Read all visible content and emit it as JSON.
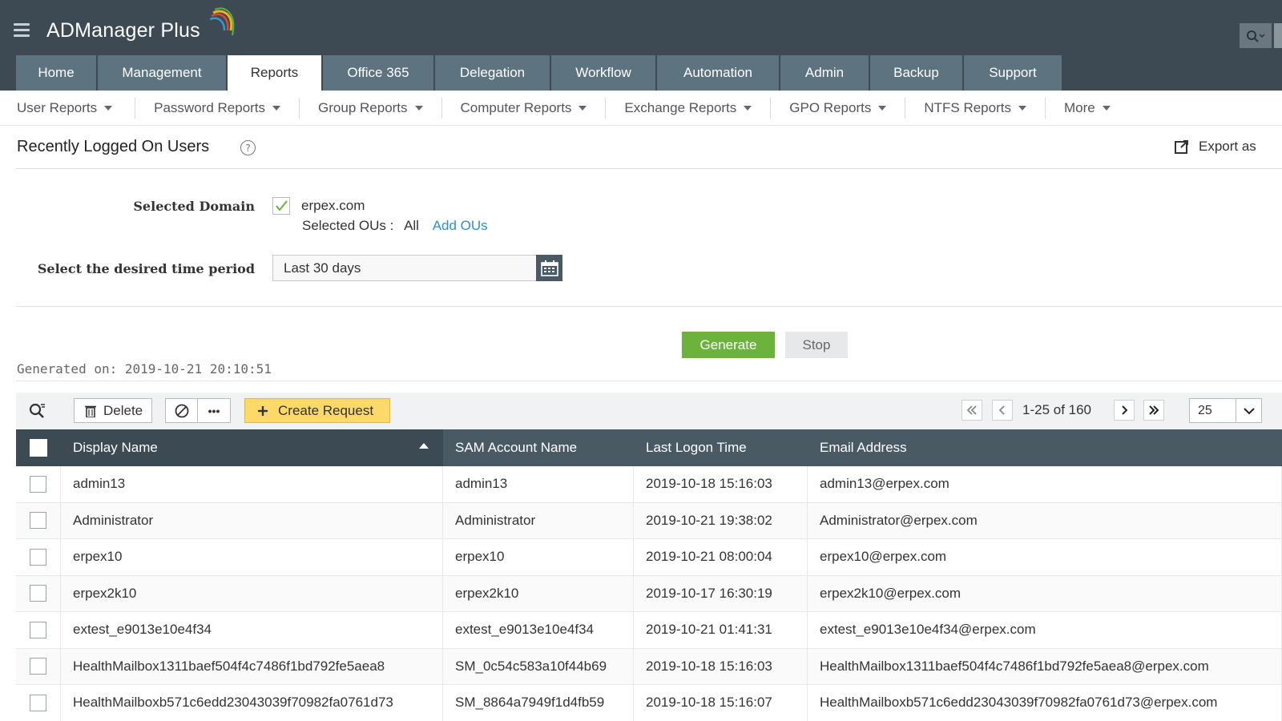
{
  "app": {
    "title": "ADManager Plus"
  },
  "tabs": [
    {
      "label": "Home",
      "active": false
    },
    {
      "label": "Management",
      "active": false
    },
    {
      "label": "Reports",
      "active": true
    },
    {
      "label": "Office 365",
      "active": false
    },
    {
      "label": "Delegation",
      "active": false
    },
    {
      "label": "Workflow",
      "active": false
    },
    {
      "label": "Automation",
      "active": false
    },
    {
      "label": "Admin",
      "active": false
    },
    {
      "label": "Backup",
      "active": false
    },
    {
      "label": "Support",
      "active": false
    }
  ],
  "subnav": [
    "User Reports",
    "Password Reports",
    "Group Reports",
    "Computer Reports",
    "Exchange Reports",
    "GPO Reports",
    "NTFS Reports",
    "More"
  ],
  "page": {
    "title": "Recently Logged On Users",
    "help": "?",
    "export_label": "Export as"
  },
  "form": {
    "domain_label": "Selected Domain",
    "domain_value": "erpex.com",
    "domain_checked": true,
    "ous_label": "Selected OUs :",
    "ous_value": "All",
    "add_ous": "Add OUs",
    "period_label": "Select the desired time period",
    "period_value": "Last 30 days"
  },
  "actions": {
    "generate": "Generate",
    "stop": "Stop"
  },
  "generated_on": "Generated on: 2019-10-21 20:10:51",
  "toolbar": {
    "delete": "Delete",
    "more": "•••",
    "create_request": "Create Request",
    "pagination": "1-25 of 160",
    "page_size": "25"
  },
  "table": {
    "columns": [
      "Display Name",
      "SAM Account Name",
      "Last Logon Time",
      "Email Address"
    ],
    "rows": [
      [
        "admin13",
        "admin13",
        "2019-10-18 15:16:03",
        "admin13@erpex.com"
      ],
      [
        "Administrator",
        "Administrator",
        "2019-10-21 19:38:02",
        "Administrator@erpex.com"
      ],
      [
        "erpex10",
        "erpex10",
        "2019-10-21 08:00:04",
        "erpex10@erpex.com"
      ],
      [
        "erpex2k10",
        "erpex2k10",
        "2019-10-17 16:30:19",
        "erpex2k10@erpex.com"
      ],
      [
        "extest_e9013e10e4f34",
        "extest_e9013e10e4f34",
        "2019-10-21 01:41:31",
        "extest_e9013e10e4f34@erpex.com"
      ],
      [
        "HealthMailbox1311baef504f4c7486f1bd792fe5aea8",
        "SM_0c54c583a10f44b69",
        "2019-10-18 15:16:03",
        "HealthMailbox1311baef504f4c7486f1bd792fe5aea8@erpex.com"
      ],
      [
        "HealthMailboxb571c6edd23043039f70982fa0761d73",
        "SM_8864a7949f1d4fb59",
        "2019-10-18 15:16:07",
        "HealthMailboxb571c6edd23043039f70982fa0761d73@erpex.com"
      ]
    ]
  },
  "colors": {
    "header_bg": "#3d4a54",
    "tab_bg": "#5d7380",
    "generate": "#6cb33e",
    "create_request": "#fdd96a",
    "link": "#2d8fd5"
  },
  "icons": [
    "menu-icon",
    "logo-arc-icon",
    "search-icon",
    "help-icon",
    "export-icon",
    "checkmark-icon",
    "calendar-icon",
    "search-filter-icon",
    "trash-icon",
    "disable-icon",
    "plus-icon",
    "first-page-icon",
    "prev-page-icon",
    "next-page-icon",
    "last-page-icon",
    "chevron-down-icon",
    "sort-ascending-icon"
  ]
}
